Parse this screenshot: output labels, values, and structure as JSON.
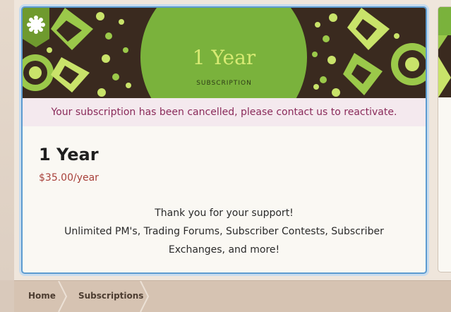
{
  "card": {
    "banner_title": "1 Year",
    "banner_subtitle": "SUBSCRIPTION",
    "ribbon_icon": "gear-badge-icon",
    "notice": "Your subscription has been cancelled, please contact us to reactivate.",
    "plan_name": "1 Year",
    "price": "$35.00/year",
    "description_line1": "Thank you for your support!",
    "description_line2": "Unlimited PM's, Trading Forums, Subscriber Contests, Subscriber",
    "description_line3": "Exchanges, and more!"
  },
  "breadcrumb": {
    "items": [
      {
        "label": "Home"
      },
      {
        "label": "Subscriptions"
      }
    ]
  },
  "colors": {
    "accent_green": "#7ab23c",
    "banner_dark": "#3a2a1f",
    "notice_text": "#8a2a5a",
    "price_text": "#a8413a",
    "card_border": "#5c9bd0"
  }
}
